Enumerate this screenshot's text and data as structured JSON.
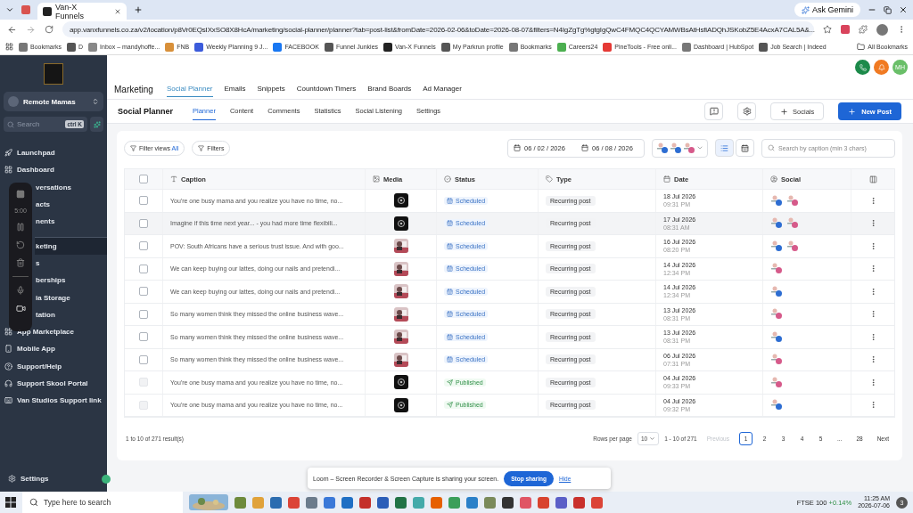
{
  "browser": {
    "tab_title": "Van-X Funnels",
    "ask_button": "Ask Gemini",
    "url": "app.vanxfunnels.co.za/v2/location/p8Vr0EQsIXxSO8X8HcA/marketing/social-planner/planner?tab=post-list&fromDate=2026-02-06&toDate=2026-08-07&filters=N4IgZgTg%gtgIgQwC4FMQC4QCYAMWBsAtHsfiADQhJSKobZ5E4AcxA7CAL5A&...",
    "bookmarks": [
      "Bookmarks",
      "D",
      "Inbox – mandyhoffe...",
      "FNB",
      "Weekly Planning 9 J...",
      "FACEBOOK",
      "Funnel Junkies",
      "Van-X Funnels",
      "My Parkrun profile",
      "Bookmarks",
      "Careers24",
      "PineTools - Free onli...",
      "Dashboard | HubSpot",
      "Job Search | Indeed"
    ],
    "all_bookmarks": "All Bookmarks"
  },
  "sidebar": {
    "account": "Remote Mamas",
    "search_placeholder": "Search",
    "shortcut": "ctrl K",
    "items": [
      {
        "label": "Launchpad",
        "kind": "full",
        "selected": false
      },
      {
        "label": "Dashboard",
        "kind": "full",
        "selected": false
      },
      {
        "label": "versations",
        "kind": "covered",
        "selected": false
      },
      {
        "label": "acts",
        "kind": "covered",
        "selected": false
      },
      {
        "label": "nents",
        "kind": "covered",
        "selected": false
      },
      {
        "label": "keting",
        "kind": "covered",
        "selected": true
      },
      {
        "label": "s",
        "kind": "covered",
        "selected": false
      },
      {
        "label": "berships",
        "kind": "covered",
        "selected": false
      },
      {
        "label": "ia Storage",
        "kind": "covered",
        "selected": false
      },
      {
        "label": "tation",
        "kind": "covered",
        "selected": false
      },
      {
        "label": "App Marketplace",
        "kind": "full",
        "selected": false
      },
      {
        "label": "Mobile App",
        "kind": "full",
        "selected": false
      },
      {
        "label": "Support/Help",
        "kind": "full",
        "selected": false
      },
      {
        "label": "Support Skool Portal",
        "kind": "full",
        "selected": false
      },
      {
        "label": "Van Studios Support link",
        "kind": "full",
        "selected": false
      }
    ],
    "settings": "Settings"
  },
  "recorder": {
    "timer": "5:00"
  },
  "header": {
    "avatar": "MH"
  },
  "top_nav": {
    "title": "Marketing",
    "tabs": [
      {
        "label": "Social Planner",
        "selected": true
      },
      {
        "label": "Emails",
        "selected": false
      },
      {
        "label": "Snippets",
        "selected": false
      },
      {
        "label": "Countdown Timers",
        "selected": false
      },
      {
        "label": "Brand Boards",
        "selected": false
      },
      {
        "label": "Ad Manager",
        "selected": false
      }
    ]
  },
  "sub_nav": {
    "title": "Social Planner",
    "tabs": [
      {
        "label": "Planner",
        "selected": true
      },
      {
        "label": "Content",
        "selected": false
      },
      {
        "label": "Comments",
        "selected": false
      },
      {
        "label": "Statistics",
        "selected": false
      },
      {
        "label": "Social Listening",
        "selected": false
      },
      {
        "label": "Settings",
        "selected": false
      }
    ],
    "socials_button": "Socials",
    "new_post_button": "New Post"
  },
  "toolbar": {
    "filter_views": "Filter views",
    "filter_views_value": "All",
    "filters": "Filters",
    "from_date": "06 / 02 / 2026",
    "to_date": "06 / 08 / 2026",
    "views": [
      {
        "kind": "list",
        "selected": true
      },
      {
        "kind": "calendar",
        "selected": false
      }
    ],
    "search_placeholder": "Search by caption (min 3 chars)"
  },
  "table": {
    "select_all": {
      "checked": false
    },
    "columns": [
      "Caption",
      "Media",
      "Status",
      "Type",
      "Date",
      "Social"
    ],
    "rows": [
      {
        "caption": "You're one busy mama and you realize you have no time, no...",
        "media": {
          "kind": "video"
        },
        "status": {
          "kind": "scheduled",
          "label": "Scheduled"
        },
        "type": "Recurring post",
        "date": "18 Jul 2026",
        "time": "09:31 PM",
        "social": [
          {
            "kind": "facebook"
          },
          {
            "kind": "instagram"
          }
        ],
        "disabled": false,
        "hovered": false
      },
      {
        "caption": "Imagine if this time next year... - you had more time flexibili...",
        "media": {
          "kind": "video"
        },
        "status": {
          "kind": "scheduled",
          "label": "Scheduled"
        },
        "type": "Recurring post",
        "date": "17 Jul 2026",
        "time": "08:31 AM",
        "social": [
          {
            "kind": "facebook"
          },
          {
            "kind": "instagram"
          }
        ],
        "disabled": false,
        "hovered": true
      },
      {
        "caption": "POV: South Africans have a serious trust issue. And with goo...",
        "media": {
          "kind": "picture"
        },
        "status": {
          "kind": "scheduled",
          "label": "Scheduled"
        },
        "type": "Recurring post",
        "date": "16 Jul 2026",
        "time": "08:20 PM",
        "social": [
          {
            "kind": "facebook"
          },
          {
            "kind": "instagram"
          }
        ],
        "disabled": false,
        "hovered": false
      },
      {
        "caption": "We can keep buying our lattes, doing our nails and pretendi...",
        "media": {
          "kind": "picture"
        },
        "status": {
          "kind": "scheduled",
          "label": "Scheduled"
        },
        "type": "Recurring post",
        "date": "14 Jul 2026",
        "time": "12:34 PM",
        "social": [
          {
            "kind": "instagram"
          }
        ],
        "disabled": false,
        "hovered": false
      },
      {
        "caption": "We can keep buying our lattes, doing our nails and pretendi...",
        "media": {
          "kind": "picture"
        },
        "status": {
          "kind": "scheduled",
          "label": "Scheduled"
        },
        "type": "Recurring post",
        "date": "14 Jul 2026",
        "time": "12:34 PM",
        "social": [
          {
            "kind": "facebook"
          }
        ],
        "disabled": false,
        "hovered": false
      },
      {
        "caption": "So many women think they missed the online business wave...",
        "media": {
          "kind": "picture"
        },
        "status": {
          "kind": "scheduled",
          "label": "Scheduled"
        },
        "type": "Recurring post",
        "date": "13 Jul 2026",
        "time": "08:31 PM",
        "social": [
          {
            "kind": "instagram"
          }
        ],
        "disabled": false,
        "hovered": false
      },
      {
        "caption": "So many women think they missed the online business wave...",
        "media": {
          "kind": "picture"
        },
        "status": {
          "kind": "scheduled",
          "label": "Scheduled"
        },
        "type": "Recurring post",
        "date": "13 Jul 2026",
        "time": "08:31 PM",
        "social": [
          {
            "kind": "facebook"
          }
        ],
        "disabled": false,
        "hovered": false
      },
      {
        "caption": "So many women think they missed the online business wave...",
        "media": {
          "kind": "picture"
        },
        "status": {
          "kind": "scheduled",
          "label": "Scheduled"
        },
        "type": "Recurring post",
        "date": "06 Jul 2026",
        "time": "07:31 PM",
        "social": [
          {
            "kind": "instagram"
          }
        ],
        "disabled": false,
        "hovered": false
      },
      {
        "caption": "You're one busy mama and you realize you have no time, no...",
        "media": {
          "kind": "video"
        },
        "status": {
          "kind": "published",
          "label": "Published"
        },
        "type": "Recurring post",
        "date": "04 Jul 2026",
        "time": "09:33 PM",
        "social": [
          {
            "kind": "instagram"
          }
        ],
        "disabled": true,
        "hovered": false
      },
      {
        "caption": "You're one busy mama and you realize you have no time, no...",
        "media": {
          "kind": "video"
        },
        "status": {
          "kind": "published",
          "label": "Published"
        },
        "type": "Recurring post",
        "date": "04 Jul 2026",
        "time": "09:32 PM",
        "social": [
          {
            "kind": "facebook"
          }
        ],
        "disabled": true,
        "hovered": false
      }
    ]
  },
  "footer": {
    "results": "1 to 10 of 271 result(s)",
    "rows_per_page_label": "Rows per page",
    "rows_per_page": "10",
    "range": "1 - 10 of 271",
    "previous": "Previous",
    "previous_disabled": true,
    "pages": [
      {
        "label": "1",
        "selected": true
      },
      {
        "label": "2",
        "selected": false
      },
      {
        "label": "3",
        "selected": false
      },
      {
        "label": "4",
        "selected": false
      },
      {
        "label": "5",
        "selected": false
      },
      {
        "label": "...",
        "selected": false
      },
      {
        "label": "28",
        "selected": false
      }
    ],
    "next": "Next"
  },
  "loom_banner": {
    "message": "Loom – Screen Recorder & Screen Capture is sharing your screen.",
    "stop_button": "Stop sharing",
    "hide_link": "Hide"
  },
  "taskbar": {
    "search_placeholder": "Type here to search",
    "ticker": "FTSE 100",
    "change": "+0.14%",
    "time": "11:25 AM",
    "date": "2026-07-06",
    "notifications": "3"
  }
}
